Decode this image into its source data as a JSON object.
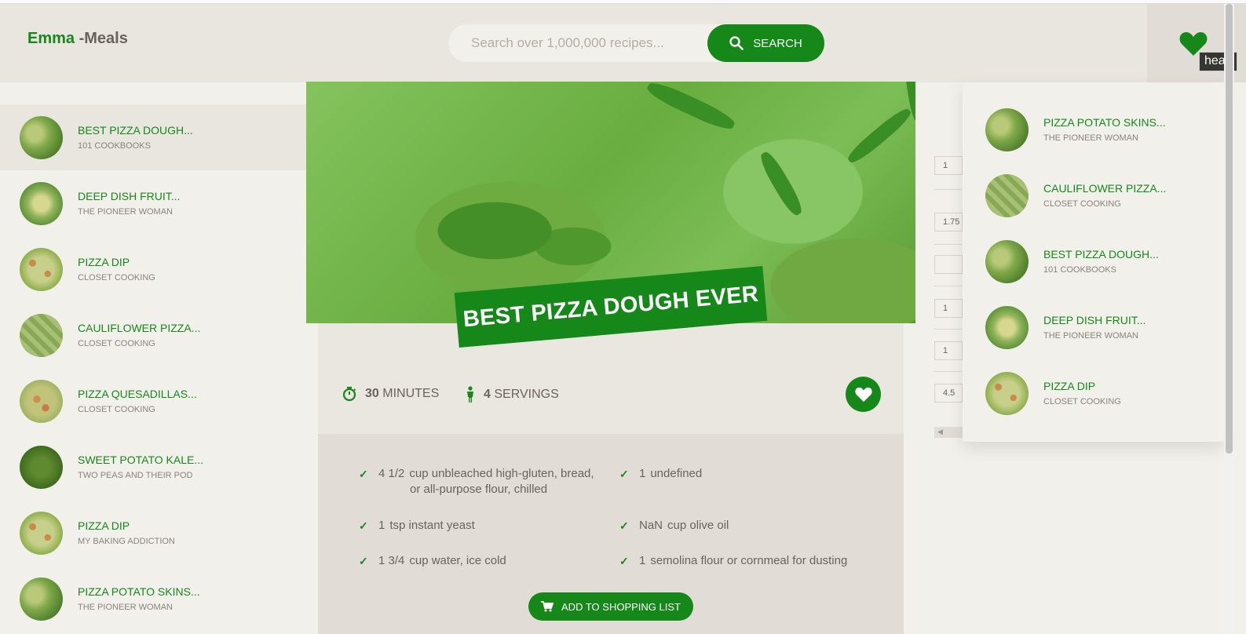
{
  "header": {
    "logo_first": "Emma",
    "logo_rest": " -Meals",
    "search_placeholder": "Search over 1,000,000 recipes...",
    "search_button": "SEARCH",
    "likes_tooltip": "heart"
  },
  "results": [
    {
      "title": "BEST PIZZA DOUGH...",
      "publisher": "101 COOKBOOKS",
      "active": true
    },
    {
      "title": "DEEP DISH FRUIT...",
      "publisher": "THE PIONEER WOMAN"
    },
    {
      "title": "PIZZA DIP",
      "publisher": "CLOSET COOKING"
    },
    {
      "title": "CAULIFLOWER PIZZA...",
      "publisher": "CLOSET COOKING"
    },
    {
      "title": "PIZZA QUESADILLAS...",
      "publisher": "CLOSET COOKING"
    },
    {
      "title": "SWEET POTATO KALE...",
      "publisher": "TWO PEAS AND THEIR POD"
    },
    {
      "title": "PIZZA DIP",
      "publisher": "MY BAKING ADDICTION"
    },
    {
      "title": "PIZZA POTATO SKINS...",
      "publisher": "THE PIONEER WOMAN"
    }
  ],
  "recipe": {
    "title": "BEST PIZZA DOUGH EVER",
    "minutes": "30",
    "minutes_label": "MINUTES",
    "servings": "4",
    "servings_label": "SERVINGS",
    "ingredients": [
      {
        "count": "4 1/2",
        "text": "cup unbleached high-gluten, bread,",
        "text2": "or all-purpose flour, chilled"
      },
      {
        "count": "1",
        "text": "undefined"
      },
      {
        "count": "1",
        "text": "tsp instant yeast"
      },
      {
        "count": "NaN",
        "text": "cup olive oil"
      },
      {
        "count": "1 3/4",
        "text": "cup water, ice cold"
      },
      {
        "count": "1",
        "text": "semolina flour or cornmeal for dusting"
      }
    ],
    "shopping_button": "ADD TO SHOPPING LIST"
  },
  "shopping_values": [
    "1",
    "1.75",
    "",
    "1",
    "1",
    "4.5"
  ],
  "likes": [
    {
      "title": "PIZZA POTATO SKINS...",
      "publisher": "THE PIONEER WOMAN"
    },
    {
      "title": "CAULIFLOWER PIZZA...",
      "publisher": "CLOSET COOKING"
    },
    {
      "title": "BEST PIZZA DOUGH...",
      "publisher": "101 COOKBOOKS"
    },
    {
      "title": "DEEP DISH FRUIT...",
      "publisher": "THE PIONEER WOMAN"
    },
    {
      "title": "PIZZA DIP",
      "publisher": "CLOSET COOKING"
    }
  ],
  "colors": {
    "accent": "#16881a",
    "text": "#6b625c"
  }
}
